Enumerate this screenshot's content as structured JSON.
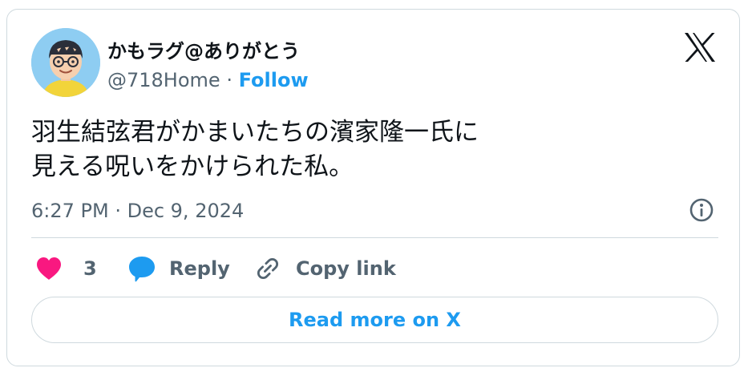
{
  "author": {
    "display_name": "かもラグ@ありがとう",
    "handle": "@718Home",
    "separator": "·",
    "follow_label": "Follow"
  },
  "tweet": {
    "text_lines": [
      "羽生結弦君がかまいたちの濱家隆一氏に",
      "見える呪いをかけられた私。"
    ],
    "timestamp": "6:27 PM · Dec 9, 2024"
  },
  "actions": {
    "like_count": "3",
    "reply_label": "Reply",
    "copy_link_label": "Copy link"
  },
  "read_more_label": "Read more on X",
  "icons": {
    "brand": "x-logo-icon",
    "info": "info-icon",
    "like": "heart-icon",
    "reply": "speech-bubble-icon",
    "copy": "link-icon"
  },
  "colors": {
    "text_primary": "#0f1419",
    "text_secondary": "#536471",
    "accent_blue": "#1d9bf0",
    "like_pink": "#f91880",
    "border": "#cfd9de"
  }
}
